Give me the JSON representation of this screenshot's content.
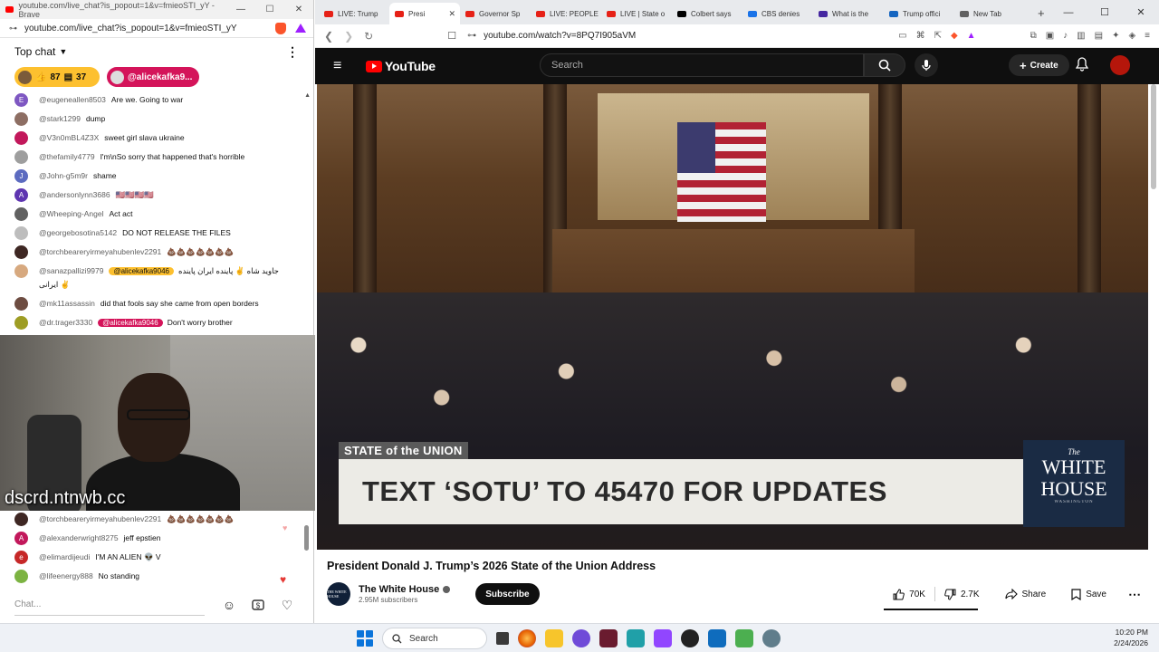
{
  "left_window": {
    "title": "youtube.com/live_chat?is_popout=1&v=fmieoSTI_yY - Brave",
    "url": "youtube.com/live_chat?is_popout=1&v=fmieoSTI_yY",
    "win_controls": [
      "—",
      "☐",
      "✕"
    ]
  },
  "chat": {
    "header": "Top chat",
    "more_icon": "⋮",
    "pinned_yellow": {
      "likes": "87",
      "chats": "37"
    },
    "pinned_pink": "@alicekafka9...",
    "messages": [
      {
        "author": "@eugeneallen8503",
        "text": "Are we. Going to war",
        "initial": "E",
        "color": "#7e57c2"
      },
      {
        "author": "@stark1299",
        "text": "dump",
        "initial": "",
        "color": "#8d6e63"
      },
      {
        "author": "@V3n0mBL4Z3X",
        "text": "sweet girl slava ukraine",
        "initial": "",
        "color": "#c2185b"
      },
      {
        "author": "@thefamily4779",
        "text": "I'm\\nSo sorry that happened that's horrible",
        "initial": "",
        "color": "#9e9e9e"
      },
      {
        "author": "@John-g5m9r",
        "text": "shame",
        "initial": "J",
        "color": "#5c6bc0"
      },
      {
        "author": "@andersonlynn3686",
        "text": "🇺🇸🇺🇸🇺🇸🇺🇸",
        "initial": "A",
        "color": "#5e35b1"
      },
      {
        "author": "@Wheeping-Angel",
        "text": "Act act",
        "initial": "",
        "color": "#616161"
      },
      {
        "author": "@georgebosotina5142",
        "text": "DO NOT RELEASE THE FILES",
        "initial": "",
        "color": "#bdbdbd"
      },
      {
        "author": "@torchbeareryirmeyahubenlev2291",
        "text": "💩💩💩💩💩💩💩",
        "initial": "",
        "color": "#3e2723"
      },
      {
        "author": "@sanazpallizi9979",
        "mention": "@alicekafka9046",
        "text": "جاوید شاه ✌️ پاینده ایران پاینده ایرانی ✌️",
        "initial": "",
        "color": "#d7a97f"
      },
      {
        "author": "@mk11assassin",
        "text": "did that fools say she came from open borders",
        "initial": "",
        "color": "#6d4c41"
      },
      {
        "author": "@dr.trager3330",
        "mention": "@alicekafka9046",
        "text": "Don't worry brother",
        "initial": "",
        "color": "#9e9d24"
      }
    ],
    "messages_bottom": [
      {
        "author": "@torchbeareryirmeyahubenlev2291",
        "text": "💩💩💩💩💩💩💩",
        "initial": "",
        "color": "#3e2723"
      },
      {
        "author": "@alexanderwright8275",
        "text": "jeff epstien",
        "initial": "A",
        "color": "#c2185b"
      },
      {
        "author": "@elimardijeudi",
        "text": "I'M AN ALIEN 👽 V",
        "initial": "e",
        "color": "#c62828"
      },
      {
        "author": "@lifeenergy888",
        "text": "No standing",
        "initial": "",
        "color": "#7cb342"
      }
    ],
    "input_placeholder": "Chat...",
    "webcam_tag": "dscrd.ntnwb.cc"
  },
  "browser": {
    "tabs": [
      {
        "label": "LIVE: Trump",
        "fav_color": "#e62117"
      },
      {
        "label": "Presi",
        "fav_color": "#e62117",
        "active": true
      },
      {
        "label": "Governor Sp",
        "fav_color": "#e62117"
      },
      {
        "label": "LIVE: PEOPLE",
        "fav_color": "#e62117"
      },
      {
        "label": "LIVE | State o",
        "fav_color": "#e62117"
      },
      {
        "label": "Colbert says",
        "fav_color": "#000000"
      },
      {
        "label": "CBS denies",
        "fav_color": "#1a73e8"
      },
      {
        "label": "What is the",
        "fav_color": "#4527a0"
      },
      {
        "label": "Trump offici",
        "fav_color": "#1565c0"
      },
      {
        "label": "New Tab",
        "fav_color": "#616161"
      }
    ],
    "url": "youtube.com/watch?v=8PQ7I905aVM"
  },
  "youtube": {
    "logo_text": "YouTube",
    "search_placeholder": "Search",
    "create_label": "Create",
    "video": {
      "overlay_label": "STATE of the UNION",
      "banner_text": "TEXT ‘SOTU’ TO 45470 FOR UPDATES",
      "logo_the": "The",
      "logo_line1": "WHITE",
      "logo_line2": "HOUSE",
      "logo_sub": "WASHINGTON"
    },
    "title": "President Donald J. Trump’s 2026 State of the Union Address",
    "channel": {
      "name": "The White House",
      "subscribers": "2.95M subscribers",
      "avatar_text": "THE WHITE HOUSE"
    },
    "subscribe_label": "Subscribe",
    "likes": "70K",
    "dislikes": "2.7K",
    "share_label": "Share",
    "save_label": "Save"
  },
  "taskbar": {
    "search_label": "Search",
    "time": "10:20 PM",
    "date": "2/24/2026"
  }
}
